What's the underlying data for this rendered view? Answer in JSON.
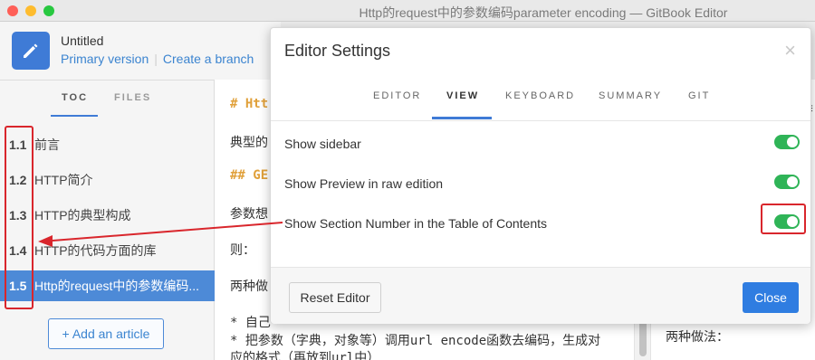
{
  "window": {
    "title": "Http的request中的参数编码parameter encoding — GitBook Editor"
  },
  "book": {
    "title": "Untitled",
    "primary_version": "Primary version",
    "create_branch": "Create a branch"
  },
  "sidebar": {
    "tabs": [
      {
        "label": "TOC"
      },
      {
        "label": "FILES"
      }
    ],
    "items": [
      {
        "num": "1.1",
        "label": "前言"
      },
      {
        "num": "1.2",
        "label": "HTTP简介"
      },
      {
        "num": "1.3",
        "label": "HTTP的典型构成"
      },
      {
        "num": "1.4",
        "label": "HTTP的代码方面的库"
      },
      {
        "num": "1.5",
        "label": "Http的request中的参数编码..."
      }
    ],
    "add_article": "+ Add an article"
  },
  "editor": {
    "lines": [
      {
        "text": "# Htt"
      },
      {
        "text": "典型的"
      },
      {
        "text": "## GE"
      },
      {
        "text": "参数想"
      },
      {
        "text": "则："
      },
      {
        "text": "两种做"
      },
      {
        "text": "* 自己"
      },
      {
        "text": "* 把参数（字典，对象等）调用url encode函数去编码，生成对"
      },
      {
        "text": "应的格式（再放到url中）"
      }
    ]
  },
  "preview": {
    "text": "两种做法：",
    "menu_icon": "≡"
  },
  "modal": {
    "title": "Editor Settings",
    "close": "×",
    "tabs": [
      {
        "label": "EDITOR"
      },
      {
        "label": "VIEW"
      },
      {
        "label": "KEYBOARD"
      },
      {
        "label": "SUMMARY"
      },
      {
        "label": "GIT"
      }
    ],
    "active_tab": "VIEW",
    "settings": [
      {
        "label": "Show sidebar",
        "enabled": true
      },
      {
        "label": "Show Preview in raw edition",
        "enabled": true
      },
      {
        "label": "Show Section Number in the Table of Contents",
        "enabled": true
      }
    ],
    "reset_label": "Reset Editor",
    "close_label": "Close"
  },
  "colors": {
    "accent": "#3f7bd6",
    "toggle_on": "#2fb457",
    "annotation_red": "#d9262c",
    "heading_orange": "#e0a03a",
    "active_item": "#4d8ad7"
  }
}
